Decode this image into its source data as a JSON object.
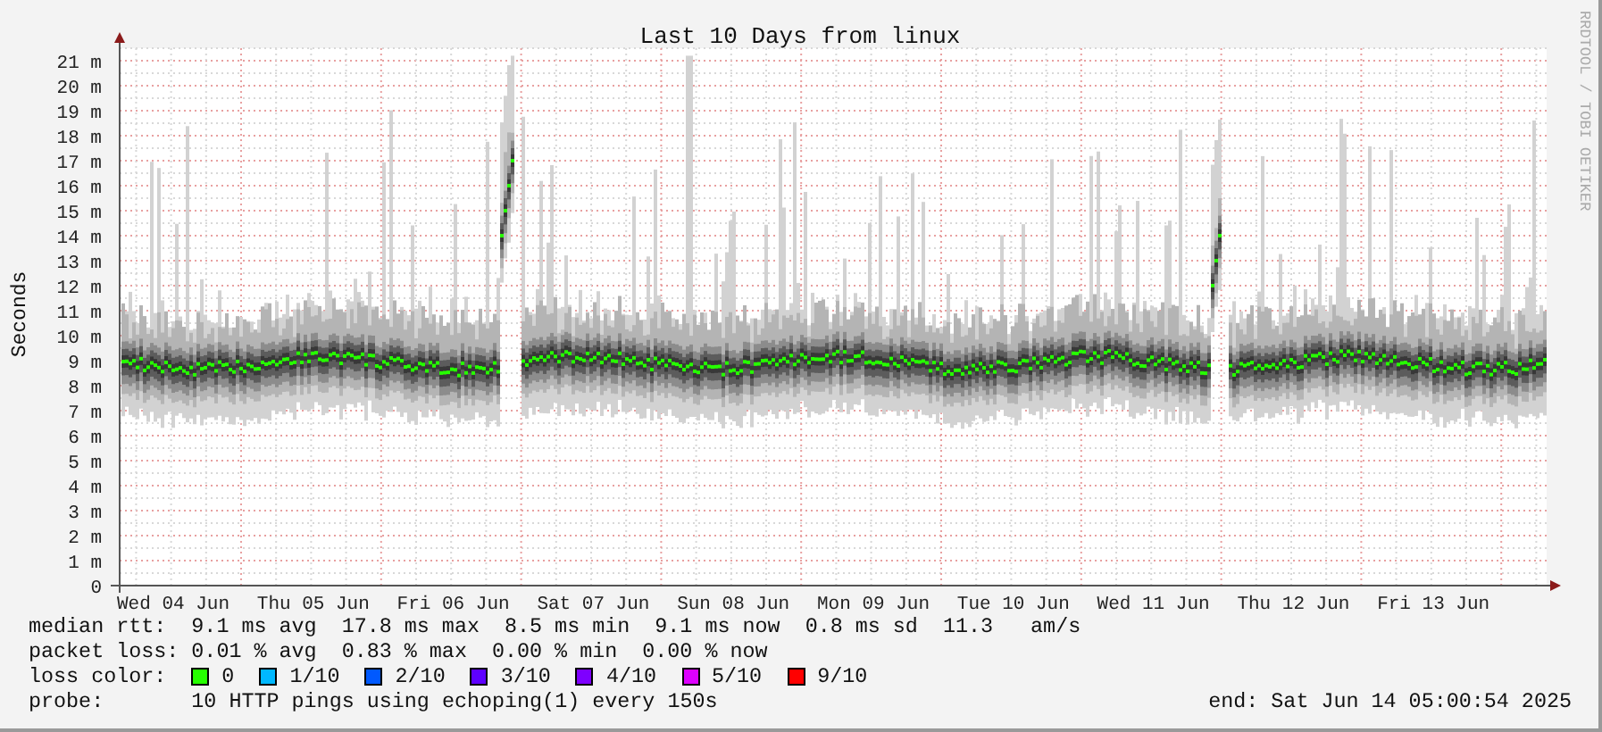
{
  "title": "Last 10 Days from linux",
  "credit": "RRDTOOL / TOBI OETIKER",
  "y_axis": {
    "label": "Seconds",
    "ticks": [
      "21 m",
      "20 m",
      "19 m",
      "18 m",
      "17 m",
      "16 m",
      "15 m",
      "14 m",
      "13 m",
      "12 m",
      "11 m",
      "10 m",
      "9 m",
      "8 m",
      "7 m",
      "6 m",
      "5 m",
      "4 m",
      "3 m",
      "2 m",
      "1 m",
      "0"
    ]
  },
  "x_axis": {
    "ticks": [
      "Wed 04 Jun",
      "Thu 05 Jun",
      "Fri 06 Jun",
      "Sat 07 Jun",
      "Sun 08 Jun",
      "Mon 09 Jun",
      "Tue 10 Jun",
      "Wed 11 Jun",
      "Thu 12 Jun",
      "Fri 13 Jun"
    ]
  },
  "legend": {
    "median_rtt": {
      "label": "median rtt:",
      "values": [
        "9.1 ms avg",
        "17.8 ms max",
        "8.5 ms min",
        "9.1 ms now",
        "0.8 ms sd",
        "11.3",
        "am/s"
      ]
    },
    "packet_loss": {
      "label": "packet loss:",
      "values": [
        "0.01 % avg",
        "0.83 % max",
        "0.00 % min",
        "0.00 % now"
      ]
    },
    "loss_color": {
      "label": "loss color:",
      "items": [
        {
          "label": "0",
          "color": "#26ff00"
        },
        {
          "label": "1/10",
          "color": "#00b8ff"
        },
        {
          "label": "2/10",
          "color": "#0059ff"
        },
        {
          "label": "3/10",
          "color": "#5e00ff"
        },
        {
          "label": "4/10",
          "color": "#7e00ff"
        },
        {
          "label": "5/10",
          "color": "#dd00ff"
        },
        {
          "label": "9/10",
          "color": "#ff0000"
        }
      ]
    },
    "probe": {
      "label": "probe:",
      "text": "10 HTTP pings using echoping(1) every 150s"
    },
    "end": "end: Sat Jun 14 05:00:54 2025"
  }
}
